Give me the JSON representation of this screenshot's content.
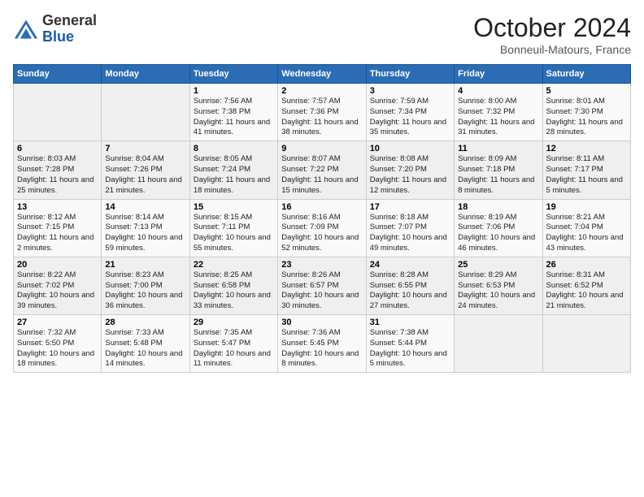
{
  "header": {
    "logo_line1": "General",
    "logo_line2": "Blue",
    "month": "October 2024",
    "location": "Bonneuil-Matours, France"
  },
  "weekdays": [
    "Sunday",
    "Monday",
    "Tuesday",
    "Wednesday",
    "Thursday",
    "Friday",
    "Saturday"
  ],
  "weeks": [
    [
      {
        "day": null
      },
      {
        "day": null
      },
      {
        "day": "1",
        "sunrise": "Sunrise: 7:56 AM",
        "sunset": "Sunset: 7:38 PM",
        "daylight": "Daylight: 11 hours and 41 minutes."
      },
      {
        "day": "2",
        "sunrise": "Sunrise: 7:57 AM",
        "sunset": "Sunset: 7:36 PM",
        "daylight": "Daylight: 11 hours and 38 minutes."
      },
      {
        "day": "3",
        "sunrise": "Sunrise: 7:59 AM",
        "sunset": "Sunset: 7:34 PM",
        "daylight": "Daylight: 11 hours and 35 minutes."
      },
      {
        "day": "4",
        "sunrise": "Sunrise: 8:00 AM",
        "sunset": "Sunset: 7:32 PM",
        "daylight": "Daylight: 11 hours and 31 minutes."
      },
      {
        "day": "5",
        "sunrise": "Sunrise: 8:01 AM",
        "sunset": "Sunset: 7:30 PM",
        "daylight": "Daylight: 11 hours and 28 minutes."
      }
    ],
    [
      {
        "day": "6",
        "sunrise": "Sunrise: 8:03 AM",
        "sunset": "Sunset: 7:28 PM",
        "daylight": "Daylight: 11 hours and 25 minutes."
      },
      {
        "day": "7",
        "sunrise": "Sunrise: 8:04 AM",
        "sunset": "Sunset: 7:26 PM",
        "daylight": "Daylight: 11 hours and 21 minutes."
      },
      {
        "day": "8",
        "sunrise": "Sunrise: 8:05 AM",
        "sunset": "Sunset: 7:24 PM",
        "daylight": "Daylight: 11 hours and 18 minutes."
      },
      {
        "day": "9",
        "sunrise": "Sunrise: 8:07 AM",
        "sunset": "Sunset: 7:22 PM",
        "daylight": "Daylight: 11 hours and 15 minutes."
      },
      {
        "day": "10",
        "sunrise": "Sunrise: 8:08 AM",
        "sunset": "Sunset: 7:20 PM",
        "daylight": "Daylight: 11 hours and 12 minutes."
      },
      {
        "day": "11",
        "sunrise": "Sunrise: 8:09 AM",
        "sunset": "Sunset: 7:18 PM",
        "daylight": "Daylight: 11 hours and 8 minutes."
      },
      {
        "day": "12",
        "sunrise": "Sunrise: 8:11 AM",
        "sunset": "Sunset: 7:17 PM",
        "daylight": "Daylight: 11 hours and 5 minutes."
      }
    ],
    [
      {
        "day": "13",
        "sunrise": "Sunrise: 8:12 AM",
        "sunset": "Sunset: 7:15 PM",
        "daylight": "Daylight: 11 hours and 2 minutes."
      },
      {
        "day": "14",
        "sunrise": "Sunrise: 8:14 AM",
        "sunset": "Sunset: 7:13 PM",
        "daylight": "Daylight: 10 hours and 59 minutes."
      },
      {
        "day": "15",
        "sunrise": "Sunrise: 8:15 AM",
        "sunset": "Sunset: 7:11 PM",
        "daylight": "Daylight: 10 hours and 55 minutes."
      },
      {
        "day": "16",
        "sunrise": "Sunrise: 8:16 AM",
        "sunset": "Sunset: 7:09 PM",
        "daylight": "Daylight: 10 hours and 52 minutes."
      },
      {
        "day": "17",
        "sunrise": "Sunrise: 8:18 AM",
        "sunset": "Sunset: 7:07 PM",
        "daylight": "Daylight: 10 hours and 49 minutes."
      },
      {
        "day": "18",
        "sunrise": "Sunrise: 8:19 AM",
        "sunset": "Sunset: 7:06 PM",
        "daylight": "Daylight: 10 hours and 46 minutes."
      },
      {
        "day": "19",
        "sunrise": "Sunrise: 8:21 AM",
        "sunset": "Sunset: 7:04 PM",
        "daylight": "Daylight: 10 hours and 43 minutes."
      }
    ],
    [
      {
        "day": "20",
        "sunrise": "Sunrise: 8:22 AM",
        "sunset": "Sunset: 7:02 PM",
        "daylight": "Daylight: 10 hours and 39 minutes."
      },
      {
        "day": "21",
        "sunrise": "Sunrise: 8:23 AM",
        "sunset": "Sunset: 7:00 PM",
        "daylight": "Daylight: 10 hours and 36 minutes."
      },
      {
        "day": "22",
        "sunrise": "Sunrise: 8:25 AM",
        "sunset": "Sunset: 6:58 PM",
        "daylight": "Daylight: 10 hours and 33 minutes."
      },
      {
        "day": "23",
        "sunrise": "Sunrise: 8:26 AM",
        "sunset": "Sunset: 6:57 PM",
        "daylight": "Daylight: 10 hours and 30 minutes."
      },
      {
        "day": "24",
        "sunrise": "Sunrise: 8:28 AM",
        "sunset": "Sunset: 6:55 PM",
        "daylight": "Daylight: 10 hours and 27 minutes."
      },
      {
        "day": "25",
        "sunrise": "Sunrise: 8:29 AM",
        "sunset": "Sunset: 6:53 PM",
        "daylight": "Daylight: 10 hours and 24 minutes."
      },
      {
        "day": "26",
        "sunrise": "Sunrise: 8:31 AM",
        "sunset": "Sunset: 6:52 PM",
        "daylight": "Daylight: 10 hours and 21 minutes."
      }
    ],
    [
      {
        "day": "27",
        "sunrise": "Sunrise: 7:32 AM",
        "sunset": "Sunset: 5:50 PM",
        "daylight": "Daylight: 10 hours and 18 minutes."
      },
      {
        "day": "28",
        "sunrise": "Sunrise: 7:33 AM",
        "sunset": "Sunset: 5:48 PM",
        "daylight": "Daylight: 10 hours and 14 minutes."
      },
      {
        "day": "29",
        "sunrise": "Sunrise: 7:35 AM",
        "sunset": "Sunset: 5:47 PM",
        "daylight": "Daylight: 10 hours and 11 minutes."
      },
      {
        "day": "30",
        "sunrise": "Sunrise: 7:36 AM",
        "sunset": "Sunset: 5:45 PM",
        "daylight": "Daylight: 10 hours and 8 minutes."
      },
      {
        "day": "31",
        "sunrise": "Sunrise: 7:38 AM",
        "sunset": "Sunset: 5:44 PM",
        "daylight": "Daylight: 10 hours and 5 minutes."
      },
      {
        "day": null
      },
      {
        "day": null
      }
    ]
  ]
}
